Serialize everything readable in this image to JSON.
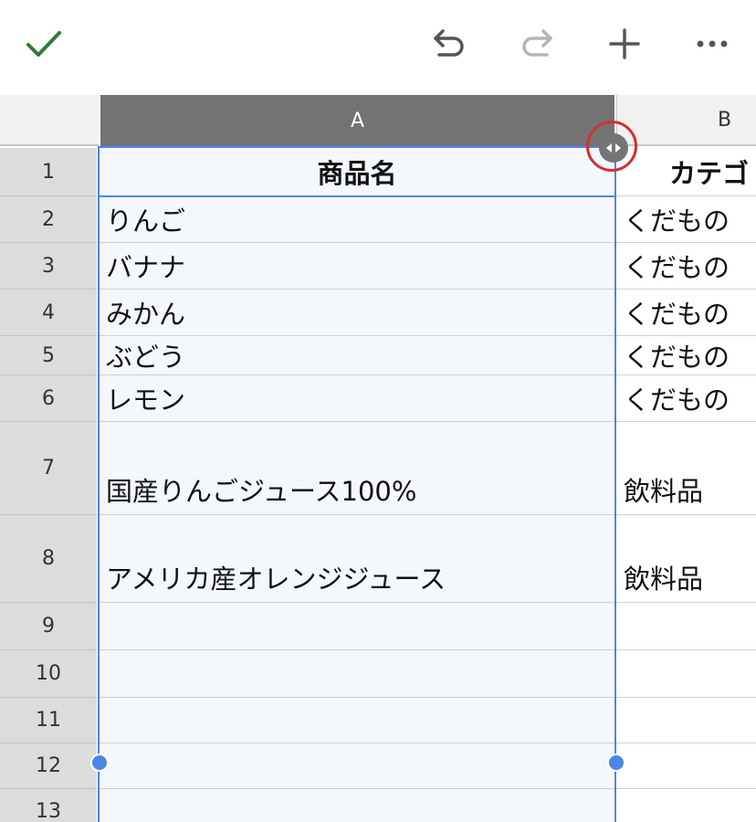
{
  "toolbar": {
    "icons": [
      "check-icon",
      "undo-icon",
      "redo-icon",
      "plus-icon",
      "more-icon"
    ],
    "colors": {
      "check": "#2e7d32",
      "icon": "#555555",
      "disabled": "#b5b5b5"
    }
  },
  "columns": [
    "A",
    "B"
  ],
  "rows": [
    {
      "num": "1",
      "a": "商品名",
      "b": "カテゴ"
    },
    {
      "num": "2",
      "a": "りんご",
      "b": "くだもの"
    },
    {
      "num": "3",
      "a": "バナナ",
      "b": "くだもの"
    },
    {
      "num": "4",
      "a": "みかん",
      "b": "くだもの"
    },
    {
      "num": "5",
      "a": "ぶどう",
      "b": "くだもの"
    },
    {
      "num": "6",
      "a": "レモン",
      "b": "くだもの"
    },
    {
      "num": "7",
      "a": "国産りんごジュース100%",
      "b": "飲料品"
    },
    {
      "num": "8",
      "a": "アメリカ産オレンジジュース",
      "b": "飲料品"
    },
    {
      "num": "9",
      "a": "",
      "b": ""
    },
    {
      "num": "10",
      "a": "",
      "b": ""
    },
    {
      "num": "11",
      "a": "",
      "b": ""
    },
    {
      "num": "12",
      "a": "",
      "b": ""
    },
    {
      "num": "13",
      "a": "",
      "b": ""
    }
  ],
  "selection": {
    "column": "A",
    "color": "#4a86e8"
  },
  "highlight_color": "#d32f2f"
}
